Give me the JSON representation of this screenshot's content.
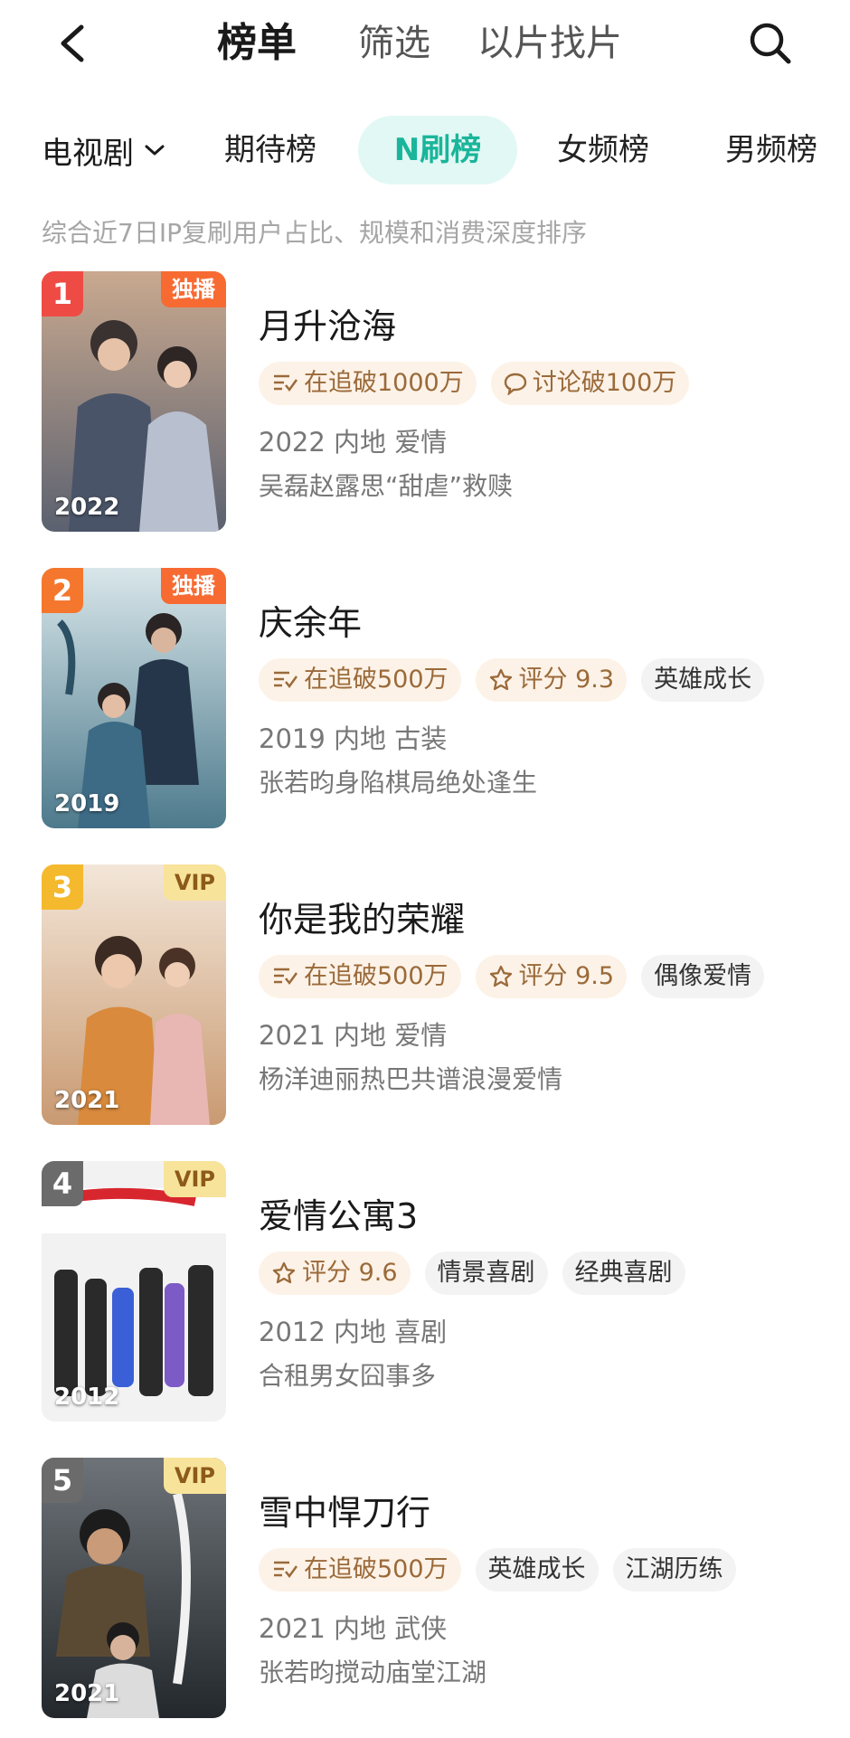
{
  "nav": {
    "tabs": [
      "榜单",
      "筛选",
      "以片找片"
    ],
    "back_icon": "chevron-left-icon",
    "search_icon": "search-icon"
  },
  "subnav": {
    "category": "电视剧",
    "tabs": [
      "期待榜",
      "N刷榜",
      "女频榜",
      "男频榜"
    ],
    "active_tab": "N刷榜"
  },
  "description": "综合近7日IP复刷用户占比、规模和消费深度排序",
  "colors": {
    "accent": "#1ab59a",
    "accent_bg": "#e2f8f4",
    "rank1": "#ef4b45",
    "rank2": "#f5772d",
    "rank3": "#f5b92e",
    "rank_other": "#6b6b6b",
    "exclusive_badge": "#f76b33",
    "vip_badge": "#f8e39a"
  },
  "items": [
    {
      "rank": "1",
      "badge": "独播",
      "year": "2022",
      "title": "月升沧海",
      "tags": [
        {
          "icon": "list-icon",
          "text": "在追破1000万"
        },
        {
          "icon": "comment-icon",
          "text": "讨论破100万"
        }
      ],
      "meta": "2022 内地 爱情",
      "subtitle": "吴磊赵露思“甜虐”救赎"
    },
    {
      "rank": "2",
      "badge": "独播",
      "year": "2019",
      "title": "庆余年",
      "tags": [
        {
          "icon": "list-icon",
          "text": "在追破500万"
        },
        {
          "icon": "star-icon",
          "text": "评分 9.3"
        },
        {
          "icon": "",
          "text": "英雄成长"
        }
      ],
      "meta": "2019 内地 古装",
      "subtitle": "张若昀身陷棋局绝处逢生"
    },
    {
      "rank": "3",
      "badge": "VIP",
      "year": "2021",
      "title": "你是我的荣耀",
      "tags": [
        {
          "icon": "list-icon",
          "text": "在追破500万"
        },
        {
          "icon": "star-icon",
          "text": "评分 9.5"
        },
        {
          "icon": "",
          "text": "偶像爱情"
        }
      ],
      "meta": "2021 内地 爱情",
      "subtitle": "杨洋迪丽热巴共谱浪漫爱情"
    },
    {
      "rank": "4",
      "badge": "VIP",
      "year": "2012",
      "title": "爱情公寓3",
      "tags": [
        {
          "icon": "star-icon",
          "text": "评分 9.6"
        },
        {
          "icon": "",
          "text": "情景喜剧"
        },
        {
          "icon": "",
          "text": "经典喜剧"
        }
      ],
      "meta": "2012 内地 喜剧",
      "subtitle": "合租男女囧事多"
    },
    {
      "rank": "5",
      "badge": "VIP",
      "year": "2021",
      "title": "雪中悍刀行",
      "tags": [
        {
          "icon": "list-icon",
          "text": "在追破500万"
        },
        {
          "icon": "",
          "text": "英雄成长"
        },
        {
          "icon": "",
          "text": "江湖历练"
        }
      ],
      "meta": "2021 内地 武侠",
      "subtitle": "张若昀搅动庙堂江湖"
    }
  ]
}
